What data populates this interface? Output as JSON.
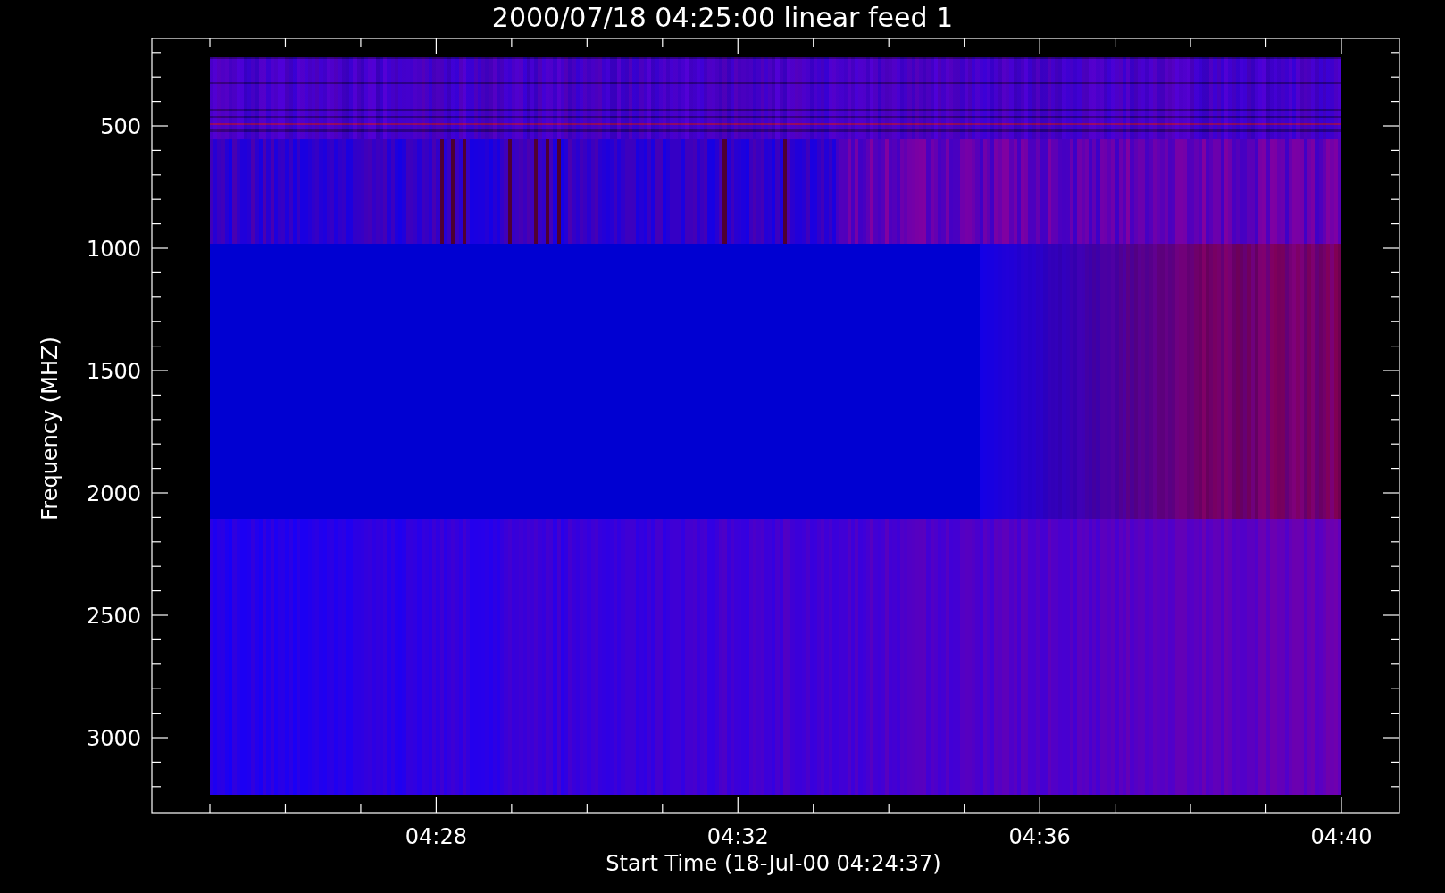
{
  "title": "2000/07/18 04:25:00 linear feed 1",
  "x_axis": {
    "label": "Start Time (18-Jul-00 04:24:37)",
    "tick_labels": [
      "04:28",
      "04:32",
      "04:36",
      "04:40"
    ]
  },
  "y_axis": {
    "label": "Frequency (MHZ)",
    "tick_labels": [
      "500",
      "1000",
      "1500",
      "2000",
      "2500",
      "3000"
    ]
  }
}
